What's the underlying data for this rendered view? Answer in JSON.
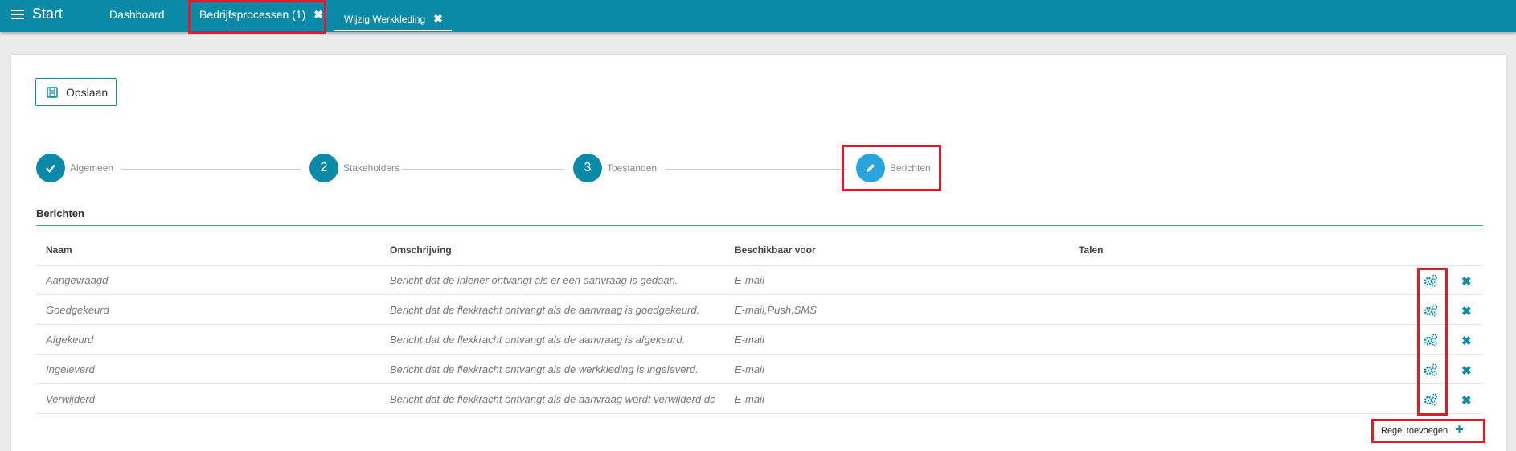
{
  "topbar": {
    "start_label": "Start",
    "tabs": [
      {
        "label": "Dashboard"
      },
      {
        "label": "Bedrijfsprocessen (1)",
        "close": "✖"
      },
      {
        "label": "Wijzig Werkkleding",
        "close": "✖"
      }
    ]
  },
  "toolbar": {
    "save_label": "Opslaan"
  },
  "steps": [
    {
      "number": "",
      "label": "Algemeen",
      "state": "done"
    },
    {
      "number": "2",
      "label": "Stakeholders",
      "state": "pending"
    },
    {
      "number": "3",
      "label": "Toestanden",
      "state": "pending"
    },
    {
      "number": "",
      "label": "Berichten",
      "state": "active"
    }
  ],
  "section": {
    "title": "Berichten"
  },
  "table": {
    "columns": [
      "Naam",
      "Omschrijving",
      "Beschikbaar voor",
      "Talen"
    ],
    "rows": [
      {
        "naam": "Aangevraagd",
        "omschrijving": "Bericht dat de inlener ontvangt als er een aanvraag is gedaan.",
        "beschikbaar": "E-mail",
        "talen": ""
      },
      {
        "naam": "Goedgekeurd",
        "omschrijving": "Bericht dat de flexkracht ontvangt als de aanvraag is goedgekeurd.",
        "beschikbaar": "E-mail,Push,SMS",
        "talen": ""
      },
      {
        "naam": "Afgekeurd",
        "omschrijving": "Bericht dat de flexkracht ontvangt als de aanvraag is afgekeurd.",
        "beschikbaar": "E-mail",
        "talen": ""
      },
      {
        "naam": "Ingeleverd",
        "omschrijving": "Bericht dat de flexkracht ontvangt als de werkkleding is ingeleverd.",
        "beschikbaar": "E-mail",
        "talen": ""
      },
      {
        "naam": "Verwijderd",
        "omschrijving": "Bericht dat de flexkracht ontvangt als de aanvraag wordt verwijderd dc",
        "beschikbaar": "E-mail",
        "talen": ""
      }
    ],
    "row_icons": {
      "settings": "cogs-icon",
      "delete": "close-icon"
    },
    "delete_glyph": "✖"
  },
  "add_row": {
    "label": "Regel toevoegen",
    "icon": "plus-icon",
    "glyph": "+"
  },
  "colors": {
    "topbar": "#0b8aa8",
    "accent": "#2aa4dc",
    "highlight": "#e21b2b"
  }
}
